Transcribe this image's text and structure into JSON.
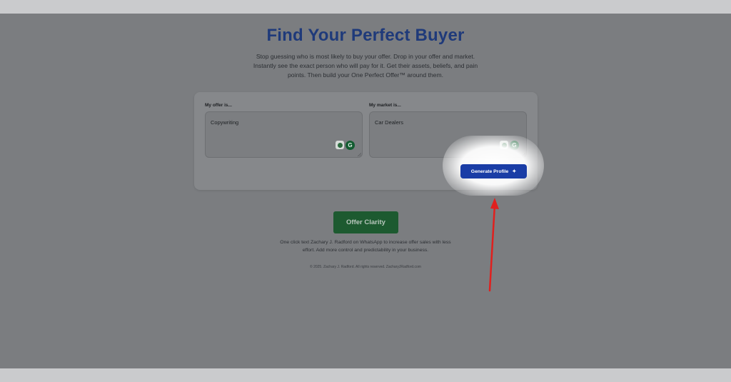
{
  "header": {
    "title": "Find Your Perfect Buyer",
    "subtitle": "Stop guessing who is most likely to buy your offer. Drop in your offer and market. Instantly see the exact person who will pay for it. Get their assets, beliefs, and pain points. Then build your One Perfect Offer™ around them."
  },
  "form": {
    "offer_label": "My offer is...",
    "offer_value": "Copywriting",
    "market_label": "My market is...",
    "market_value": "Car Dealers",
    "generate_label": "Generate Profile",
    "extension_icons": [
      "lightbulb-icon",
      "grammarly-icon"
    ]
  },
  "cta": {
    "label": "Offer Clarity",
    "tagline": "One click text Zachary J. Radford on WhatsApp to increase offer sales with less effort. Add more control and predictability in your business."
  },
  "footer": {
    "text": "© 2025. Zachary J. Radford. All rights reserved. ZacharyJRadford.com"
  },
  "annotation": {
    "arrow_color": "#e0201e",
    "highlight_color": "#ffffff"
  },
  "colors": {
    "title": "#1f3a7a",
    "primary_button": "#1a3da6",
    "cta_button": "#1d5a30"
  }
}
